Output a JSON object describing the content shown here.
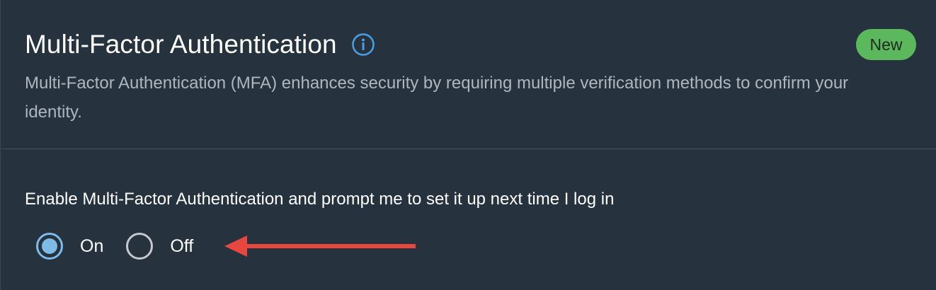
{
  "section": {
    "title": "Multi-Factor Authentication",
    "badge": "New",
    "description": "Multi-Factor Authentication (MFA) enhances security by requiring multiple verification methods to confirm your identity."
  },
  "setting": {
    "label": "Enable Multi-Factor Authentication and prompt me to set it up next time I log in",
    "options": [
      {
        "label": "On",
        "selected": true
      },
      {
        "label": "Off",
        "selected": false
      }
    ]
  },
  "colors": {
    "background": "#26323d",
    "accent": "#7fbbe8",
    "badge": "#5cb85c",
    "info_icon": "#4a9fe3",
    "annotation_arrow": "#e8473f"
  },
  "icons": {
    "info": "info-icon",
    "annotation": "arrow-left-icon"
  }
}
